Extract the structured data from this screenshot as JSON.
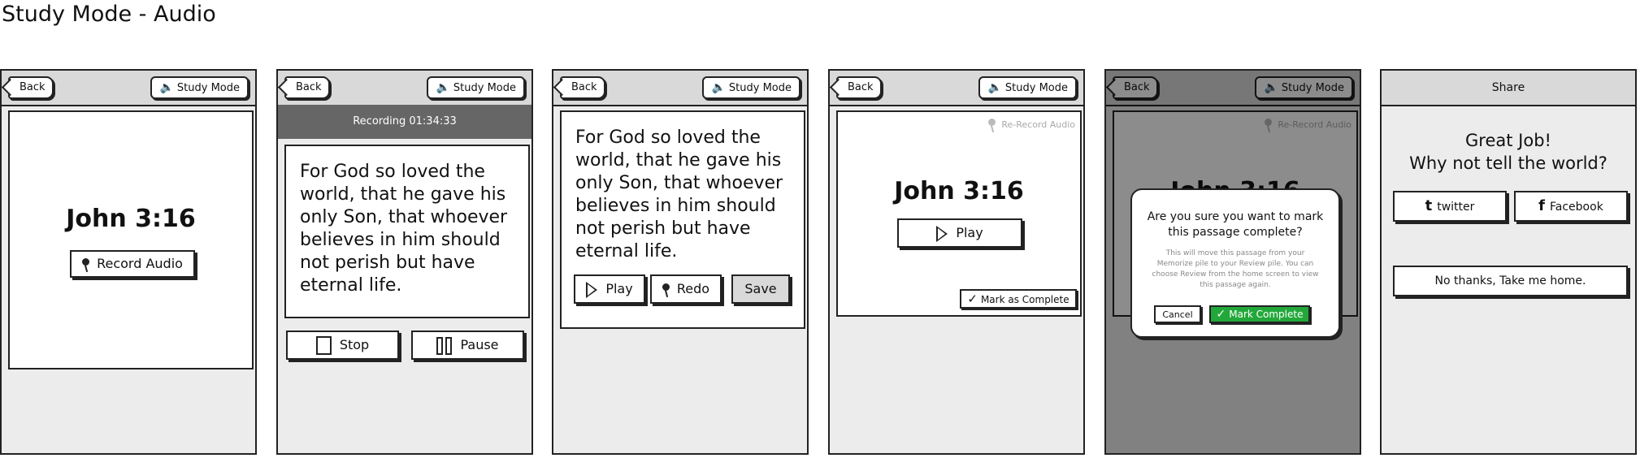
{
  "page_title": "Study Mode - Audio",
  "common": {
    "back_label": "Back",
    "study_mode_label": "Study Mode",
    "speaker_icon": "🔈"
  },
  "screen1": {
    "reference": "John 3:16",
    "record_label": "Record Audio"
  },
  "screen2": {
    "recording_label": "Recording 01:34:33",
    "verse": "For God so loved the world, that he gave his only Son, that whoever believes in him should not perish but have eternal life.",
    "stop_label": "Stop",
    "pause_label": "Pause"
  },
  "screen3": {
    "verse": "For God so loved the world, that he gave his only Son, that whoever believes in him should not perish but have eternal life.",
    "play_label": "Play",
    "redo_label": "Redo",
    "save_label": "Save"
  },
  "screen4": {
    "rerecord_label": "Re-Record Audio",
    "reference": "John 3:16",
    "play_label": "Play",
    "mark_complete_label": "Mark as Complete",
    "check_icon": "✓"
  },
  "screen5": {
    "rerecord_label": "Re-Record Audio",
    "reference_partial": "John 3:16",
    "dialog_title": "Are you sure you want to mark this passage complete?",
    "dialog_body": "This will move this passage from your Memorize pile to your Review pile. You can choose Review from the home screen to view this passage again.",
    "cancel_label": "Cancel",
    "mark_complete_label": "Mark Complete",
    "accent_color": "#22a83a",
    "check_icon": "✓"
  },
  "screen6": {
    "header_title": "Share",
    "heading_line1": "Great Job!",
    "heading_line2": "Why not tell the world?",
    "twitter_label": "twitter",
    "facebook_label": "Facebook",
    "no_thanks_label": "No thanks, Take me home."
  }
}
